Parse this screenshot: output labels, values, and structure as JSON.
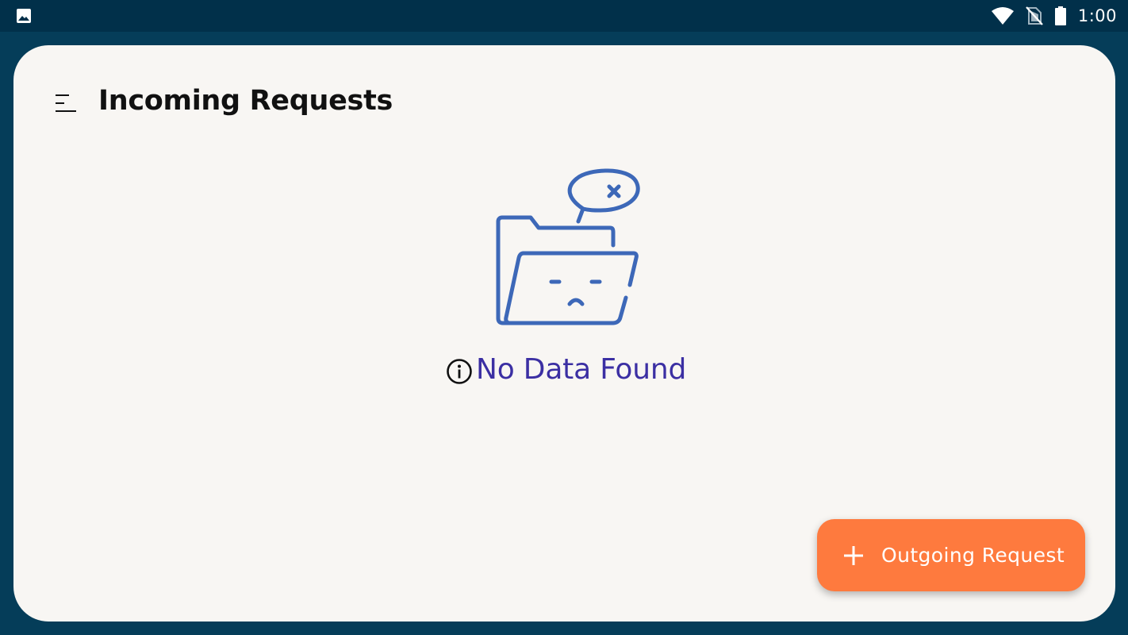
{
  "status_bar": {
    "time": "1:00",
    "left_icon": "image-icon",
    "right_icons": [
      "wifi-icon",
      "no-sim-icon",
      "battery-icon"
    ]
  },
  "header": {
    "menu_icon": "menu-icon",
    "title": "Incoming Requests"
  },
  "empty_state": {
    "illustration": "empty-folder-icon",
    "info_icon": "info-icon",
    "message": "No Data Found",
    "message_color": "#3b2fa3",
    "illustration_color": "#3d68b8"
  },
  "fab": {
    "icon": "plus-icon",
    "label": "Outgoing Request",
    "color": "#fe7a3e"
  },
  "colors": {
    "background": "#053d59",
    "status_bar": "#01304a",
    "card": "#f8f6f3"
  }
}
